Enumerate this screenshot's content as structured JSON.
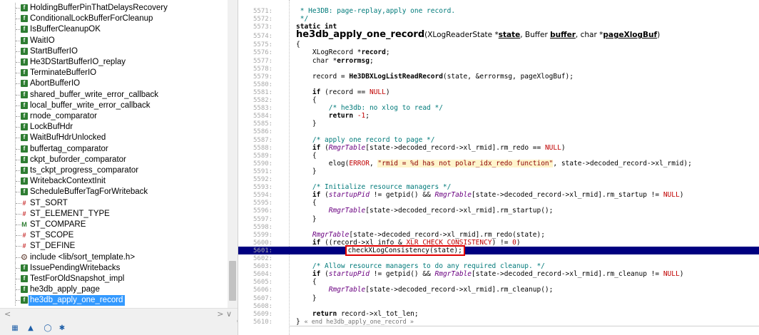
{
  "symbol_panel": {
    "items": [
      {
        "label": "HoldingBufferPinThatDelaysRecovery",
        "kind": "function",
        "icon": "function-icon"
      },
      {
        "label": "ConditionalLockBufferForCleanup",
        "kind": "function",
        "icon": "function-icon"
      },
      {
        "label": "IsBufferCleanupOK",
        "kind": "function",
        "icon": "function-icon"
      },
      {
        "label": "WaitIO",
        "kind": "function",
        "icon": "function-icon"
      },
      {
        "label": "StartBufferIO",
        "kind": "function",
        "icon": "function-icon"
      },
      {
        "label": "He3DStartBufferIO_replay",
        "kind": "function",
        "icon": "function-icon"
      },
      {
        "label": "TerminateBufferIO",
        "kind": "function",
        "icon": "function-icon"
      },
      {
        "label": "AbortBufferIO",
        "kind": "function",
        "icon": "function-icon"
      },
      {
        "label": "shared_buffer_write_error_callback",
        "kind": "function",
        "icon": "function-icon"
      },
      {
        "label": "local_buffer_write_error_callback",
        "kind": "function",
        "icon": "function-icon"
      },
      {
        "label": "rnode_comparator",
        "kind": "function",
        "icon": "function-icon"
      },
      {
        "label": "LockBufHdr",
        "kind": "function",
        "icon": "function-icon"
      },
      {
        "label": "WaitBufHdrUnlocked",
        "kind": "function",
        "icon": "function-icon"
      },
      {
        "label": "buffertag_comparator",
        "kind": "function",
        "icon": "function-icon"
      },
      {
        "label": "ckpt_buforder_comparator",
        "kind": "function",
        "icon": "function-icon"
      },
      {
        "label": "ts_ckpt_progress_comparator",
        "kind": "function",
        "icon": "function-icon"
      },
      {
        "label": "WritebackContextInit",
        "kind": "function",
        "icon": "function-icon"
      },
      {
        "label": "ScheduleBufferTagForWriteback",
        "kind": "function",
        "icon": "function-icon"
      },
      {
        "label": "ST_SORT",
        "kind": "macro",
        "icon": "macro-icon"
      },
      {
        "label": "ST_ELEMENT_TYPE",
        "kind": "macro",
        "icon": "macro-icon"
      },
      {
        "label": "ST_COMPARE",
        "kind": "enum",
        "icon": "macro-func-icon"
      },
      {
        "label": "ST_SCOPE",
        "kind": "macro",
        "icon": "macro-icon"
      },
      {
        "label": "ST_DEFINE",
        "kind": "macro",
        "icon": "macro-icon"
      },
      {
        "label": "include <lib/sort_template.h>",
        "kind": "include",
        "icon": "include-icon"
      },
      {
        "label": "IssuePendingWritebacks",
        "kind": "function",
        "icon": "function-icon"
      },
      {
        "label": "TestForOldSnapshot_impl",
        "kind": "function",
        "icon": "function-icon"
      },
      {
        "label": "he3db_apply_page",
        "kind": "function",
        "icon": "function-icon"
      },
      {
        "label": "he3db_apply_one_record",
        "kind": "function",
        "icon": "function-icon",
        "selected": true
      }
    ],
    "hscroll_left": "<",
    "hscroll_right": "> ∨"
  },
  "editor": {
    "lines": [
      {
        "n": "5571:",
        "html": " <span class=\"cm\">* He3DB: page-replay,apply one record.</span>"
      },
      {
        "n": "5572:",
        "html": " <span class=\"cm\">*/</span>"
      },
      {
        "n": "5573:",
        "html": "<span class=\"kw\">static int</span>"
      },
      {
        "n": "5574:",
        "fdef": true,
        "html": "<span class=\"fdef-name\">he3db_apply_one_record</span>(XLogReaderState *<span class=\"ul\">state</span>, Buffer <span class=\"ul\">buffer</span>, char *<span class=\"ul\">pageXlogBuf</span>)"
      },
      {
        "n": "5575:",
        "html": "{"
      },
      {
        "n": "5576:",
        "html": "    XLogRecord *<span class=\"bld\">record</span>;"
      },
      {
        "n": "5577:",
        "html": "    char *<span class=\"bld\">errormsg</span>;"
      },
      {
        "n": "5578:",
        "html": ""
      },
      {
        "n": "5579:",
        "html": "    record = <span class=\"bld\">He3DBXLogListReadRecord</span>(state, &amp;errormsg, pageXlogBuf);"
      },
      {
        "n": "5580:",
        "html": ""
      },
      {
        "n": "5581:",
        "html": "    <span class=\"kw\">if</span> (record == <span class=\"mac\">NULL</span>)"
      },
      {
        "n": "5582:",
        "html": "    {"
      },
      {
        "n": "5583:",
        "html": "        <span class=\"cm\">/* he3db: no xlog to read */</span>"
      },
      {
        "n": "5584:",
        "html": "        <span class=\"kw\">return</span> <span class=\"nu\">-1</span>;"
      },
      {
        "n": "5585:",
        "html": "    }"
      },
      {
        "n": "5586:",
        "html": ""
      },
      {
        "n": "5587:",
        "html": "    <span class=\"cm\">/* apply one record to page */</span>"
      },
      {
        "n": "5588:",
        "html": "    <span class=\"kw\">if</span> (<span class=\"it\">RmgrTable</span>[state-&gt;decoded_record-&gt;xl_rmid].rm_redo == <span class=\"mac\">NULL</span>)"
      },
      {
        "n": "5589:",
        "html": "    {"
      },
      {
        "n": "5590:",
        "html": "        elog(<span class=\"mac\">ERROR</span>, <span class=\"st\">\"rmid = %d has not polar_idx_redo function\"</span>, state-&gt;decoded_record-&gt;xl_rmid);"
      },
      {
        "n": "5591:",
        "html": "    }"
      },
      {
        "n": "5592:",
        "html": ""
      },
      {
        "n": "5593:",
        "html": "    <span class=\"cm\">/* Initialize resource managers */</span>"
      },
      {
        "n": "5594:",
        "html": "    <span class=\"kw\">if</span> (<span class=\"it\">startupPid</span> != getpid() &amp;&amp; <span class=\"it\">RmgrTable</span>[state-&gt;decoded_record-&gt;xl_rmid].rm_startup != <span class=\"mac\">NULL</span>)"
      },
      {
        "n": "5595:",
        "html": "    {"
      },
      {
        "n": "5596:",
        "html": "        <span class=\"it\">RmgrTable</span>[state-&gt;decoded_record-&gt;xl_rmid].rm_startup();"
      },
      {
        "n": "5597:",
        "html": "    }"
      },
      {
        "n": "5598:",
        "html": ""
      },
      {
        "n": "5599:",
        "html": "    <span class=\"it\">RmgrTable</span>[state-&gt;decoded_record-&gt;xl_rmid].rm_redo(state);"
      },
      {
        "n": "5600:",
        "html": "    <span class=\"kw\">if</span> ((record-&gt;xl_info &amp; <span class=\"mac\">XLR_CHECK_CONSISTENCY</span>) != <span class=\"nu\">0</span>)"
      },
      {
        "n": "5601:",
        "highlight": true,
        "html": "            <span class=\"callout\" data-name=\"highlighted-call\">checkXLogConsistency(state);</span>"
      },
      {
        "n": "5602:",
        "html": ""
      },
      {
        "n": "5603:",
        "html": "    <span class=\"cm\">/* Allow resource managers to do any required cleanup. */</span>"
      },
      {
        "n": "5604:",
        "html": "    <span class=\"kw\">if</span> (<span class=\"it\">startupPid</span> != getpid() &amp;&amp; <span class=\"it\">RmgrTable</span>[state-&gt;decoded_record-&gt;xl_rmid].rm_cleanup != <span class=\"mac\">NULL</span>)"
      },
      {
        "n": "5605:",
        "html": "    {"
      },
      {
        "n": "5606:",
        "html": "        <span class=\"it\">RmgrTable</span>[state-&gt;decoded_record-&gt;xl_rmid].rm_cleanup();"
      },
      {
        "n": "5607:",
        "html": "    }"
      },
      {
        "n": "5608:",
        "html": ""
      },
      {
        "n": "5609:",
        "html": "    <span class=\"kw\">return</span> record-&gt;xl_tot_len;"
      },
      {
        "n": "5610:",
        "html": "} <span class=\"cm\" style=\"color:#777;font-size:8.5px\">« end he3db_apply_one_record »</span>"
      }
    ]
  },
  "colors": {
    "selection": "#3399ff",
    "highlight_line": "#000080",
    "callout_border": "#e00000",
    "comment": "#007a7a"
  }
}
